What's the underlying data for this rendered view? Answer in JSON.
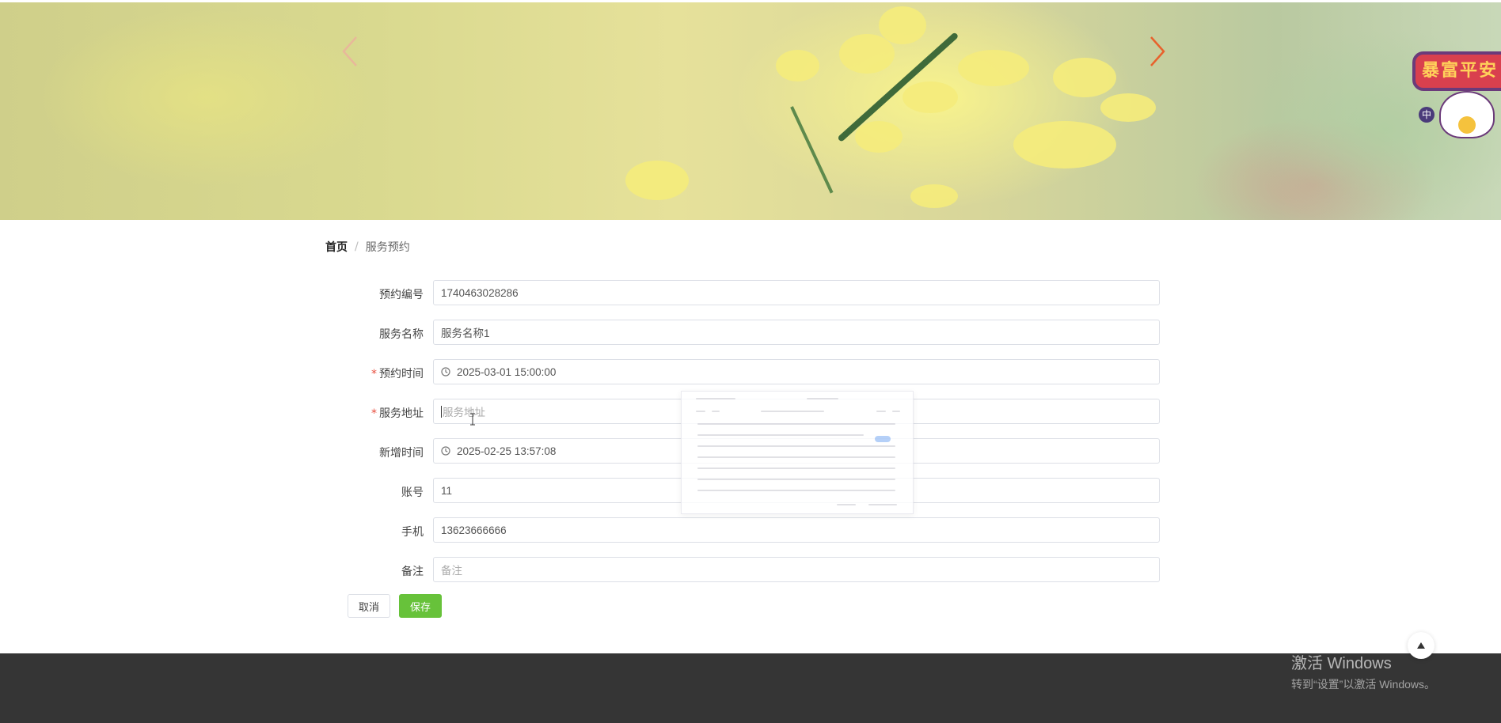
{
  "banner": {
    "badge_text": "暴富平安",
    "badge_small": "中"
  },
  "breadcrumb": {
    "home": "首页",
    "separator": "/",
    "current": "服务预约"
  },
  "form": {
    "fields": [
      {
        "label": "预约编号",
        "required": false,
        "value": "1740463028286",
        "placeholder": "",
        "icon": ""
      },
      {
        "label": "服务名称",
        "required": false,
        "value": "服务名称1",
        "placeholder": "",
        "icon": ""
      },
      {
        "label": "预约时间",
        "required": true,
        "value": "2025-03-01 15:00:00",
        "placeholder": "",
        "icon": "clock-icon"
      },
      {
        "label": "服务地址",
        "required": true,
        "value": "",
        "placeholder": "服务地址",
        "icon": ""
      },
      {
        "label": "新增时间",
        "required": false,
        "value": "2025-02-25 13:57:08",
        "placeholder": "",
        "icon": "clock-icon"
      },
      {
        "label": "账号",
        "required": false,
        "value": "11",
        "placeholder": "",
        "icon": ""
      },
      {
        "label": "手机",
        "required": false,
        "value": "13623666666",
        "placeholder": "",
        "icon": ""
      },
      {
        "label": "备注",
        "required": false,
        "value": "",
        "placeholder": "备注",
        "icon": ""
      }
    ],
    "required_mark": "*"
  },
  "buttons": {
    "cancel": "取消",
    "save": "保存"
  },
  "watermark": {
    "line1": "激活 Windows",
    "line2": "转到“设置”以激活 Windows。"
  },
  "colors": {
    "accent_green": "#67c23a",
    "required_red": "#e74c3c",
    "arrow_orange": "#e8612c",
    "footer": "#353535"
  }
}
